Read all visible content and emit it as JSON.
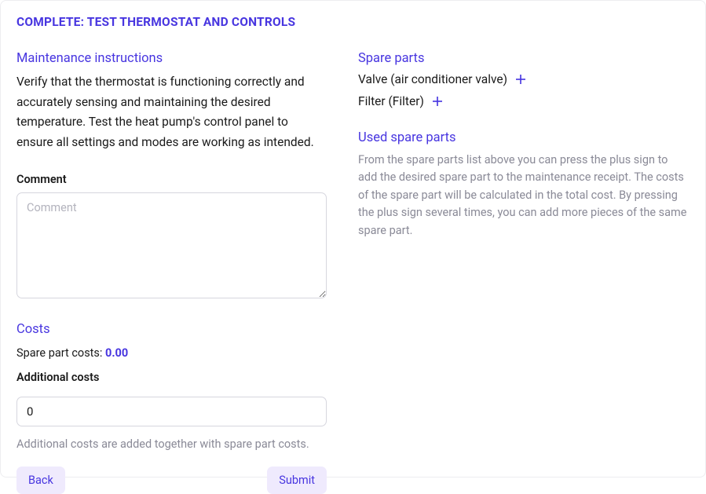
{
  "title": "COMPLETE: TEST THERMOSTAT AND CONTROLS",
  "left": {
    "instructions_heading": "Maintenance instructions",
    "instructions_text": "Verify that the thermostat is functioning correctly and accurately sensing and maintaining the desired temperature. Test the heat pump's control panel to ensure all settings and modes are working as intended.",
    "comment_label": "Comment",
    "comment_placeholder": "Comment",
    "costs_heading": "Costs",
    "spare_cost_label": "Spare part costs: ",
    "spare_cost_value": "0.00",
    "additional_label": "Additional costs",
    "additional_value": "0",
    "additional_helper": "Additional costs are added together with spare part costs.",
    "back_label": "Back",
    "submit_label": "Submit"
  },
  "right": {
    "spare_heading": "Spare parts",
    "spare_items": [
      {
        "label": "Valve (air conditioner valve)"
      },
      {
        "label": "Filter (Filter)"
      }
    ],
    "used_heading": "Used spare parts",
    "used_desc": "From the spare parts list above you can press the plus sign to add the desired spare part to the maintenance receipt. The costs of the spare part will be calculated in the total cost. By pressing the plus sign several times, you can add more pieces of the same spare part."
  }
}
